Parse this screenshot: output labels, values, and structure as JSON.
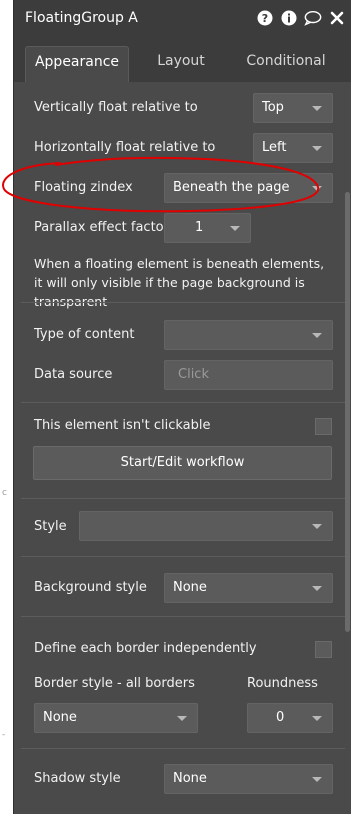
{
  "header": {
    "title": "FloatingGroup A",
    "icons": [
      "help-icon",
      "info-icon",
      "comment-icon",
      "close-icon"
    ]
  },
  "tabs": [
    {
      "label": "Appearance",
      "active": true
    },
    {
      "label": "Layout",
      "active": false
    },
    {
      "label": "Conditional",
      "active": false
    }
  ],
  "appearance": {
    "vertical_float": {
      "label": "Vertically float relative to",
      "value": "Top"
    },
    "horizontal_float": {
      "label": "Horizontally float relative to",
      "value": "Left"
    },
    "zindex": {
      "label": "Floating zindex",
      "value": "Beneath the page"
    },
    "parallax": {
      "label": "Parallax effect factor",
      "value": "1"
    },
    "note": "When a floating element is beneath elements, it will only visible if the page background is transparent",
    "content_type": {
      "label": "Type of content",
      "value": ""
    },
    "data_source": {
      "label": "Data source",
      "placeholder": "Click"
    },
    "not_clickable": {
      "label": "This element isn't clickable",
      "checked": false
    },
    "workflow_button": "Start/Edit workflow",
    "style": {
      "label": "Style",
      "value": ""
    },
    "background_style": {
      "label": "Background style",
      "value": "None"
    },
    "border_independent": {
      "label": "Define each border independently",
      "checked": false
    },
    "border_style": {
      "label": "Border style - all borders",
      "value": "None"
    },
    "roundness": {
      "label": "Roundness",
      "value": "0"
    },
    "shadow_style": {
      "label": "Shadow style",
      "value": "None"
    }
  },
  "annotation_color": "#e00000",
  "colors": {
    "panel": "#4a4a4a",
    "header": "#3c3c3c",
    "field": "#5b5b5b"
  }
}
